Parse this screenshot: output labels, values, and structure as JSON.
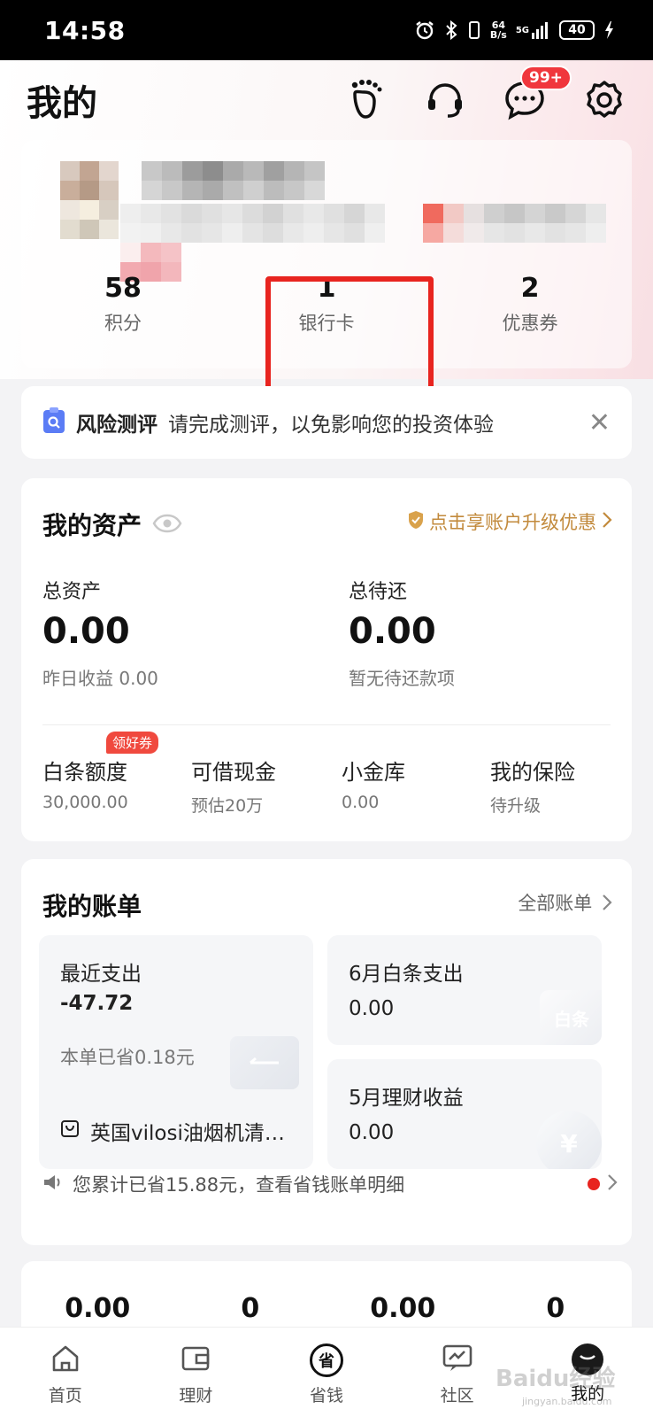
{
  "status_bar": {
    "time": "14:58",
    "net_speed_top": "64",
    "net_speed_bottom": "B/s",
    "signal_label": "5G",
    "battery": "40"
  },
  "header": {
    "title": "我的",
    "message_badge": "99+"
  },
  "profile": {
    "stats": [
      {
        "value": "58",
        "label": "积分"
      },
      {
        "value": "1",
        "label": "银行卡"
      },
      {
        "value": "2",
        "label": "优惠券"
      }
    ]
  },
  "risk_notice": {
    "title": "风险测评",
    "message": "请完成测评，以免影响您的投资体验",
    "close": "✕"
  },
  "assets": {
    "title": "我的资产",
    "upgrade_link": "点击享账户升级优惠",
    "total_assets_label": "总资产",
    "total_assets_value": "0.00",
    "yesterday_income": "昨日收益 0.00",
    "total_due_label": "总待还",
    "total_due_value": "0.00",
    "due_note": "暂无待还款项",
    "coupon_tag": "领好券",
    "quick": [
      {
        "label": "白条额度",
        "sub": "30,000.00"
      },
      {
        "label": "可借现金",
        "sub": "预估20万"
      },
      {
        "label": "小金库",
        "sub": "0.00"
      },
      {
        "label": "我的保险",
        "sub": "待升级"
      }
    ]
  },
  "bills": {
    "title": "我的账单",
    "all_link": "全部账单",
    "recent_label": "最近支出",
    "recent_value": "-47.72",
    "recent_saved": "本单已省0.18元",
    "recent_item": "英国vilosi油烟机清…",
    "june_label": "6月白条支出",
    "june_value": "0.00",
    "june_tag": "白条",
    "may_label": "5月理财收益",
    "may_value": "0.00",
    "may_tag": "¥",
    "saved_summary": "您累计已省15.88元，查看省钱账单明细"
  },
  "last_card": {
    "values": [
      "0.00",
      "0",
      "0.00",
      "0"
    ]
  },
  "bottom_nav": [
    {
      "label": "首页",
      "icon": "home-icon"
    },
    {
      "label": "理财",
      "icon": "wallet-icon"
    },
    {
      "label": "省钱",
      "icon": "save-money-icon",
      "glyph": "省"
    },
    {
      "label": "社区",
      "icon": "community-icon"
    },
    {
      "label": "我的",
      "icon": "profile-icon"
    }
  ],
  "watermark": {
    "brand": "Baidu经验",
    "url": "jingyan.baidu.com"
  },
  "colors": {
    "accent_red": "#e8241f",
    "gold": "#c28a3c",
    "badge_red": "#f0373d"
  }
}
